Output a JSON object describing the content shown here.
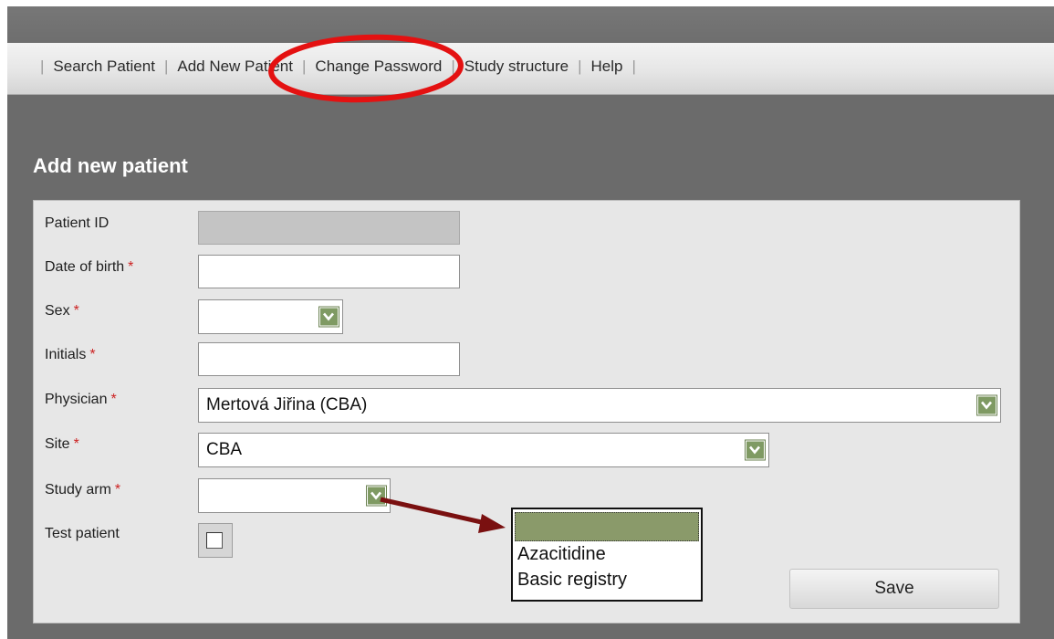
{
  "nav": {
    "items": [
      {
        "label": "Search Patient"
      },
      {
        "label": "Add New Patient"
      },
      {
        "label": "Change Password"
      },
      {
        "label": "Study structure"
      },
      {
        "label": "Help"
      }
    ],
    "separator": "|"
  },
  "page": {
    "title": "Add new patient"
  },
  "form": {
    "required_marker": "*",
    "patient_id": {
      "label": "Patient ID",
      "value": ""
    },
    "date_of_birth": {
      "label": "Date of birth",
      "value": ""
    },
    "sex": {
      "label": "Sex",
      "value": ""
    },
    "initials": {
      "label": "Initials",
      "value": ""
    },
    "physician": {
      "label": "Physician",
      "value": "Mertová Jiřina (CBA)"
    },
    "site": {
      "label": "Site",
      "value": "CBA"
    },
    "study_arm": {
      "label": "Study arm",
      "value": "",
      "options": [
        "",
        "Azacitidine",
        "Basic registry"
      ]
    },
    "test_patient": {
      "label": "Test patient",
      "checked": false
    },
    "save_label": "Save"
  },
  "colors": {
    "background": "#6b6b6b",
    "panel": "#e7e7e7",
    "select_button": "#7f9a63",
    "required": "#cc2222",
    "annotation_ellipse": "#e41111",
    "annotation_arrow": "#7a1010"
  },
  "icons": {
    "select_button": "chevron-down-icon",
    "annotation_arrow": "arrow-right-icon"
  }
}
